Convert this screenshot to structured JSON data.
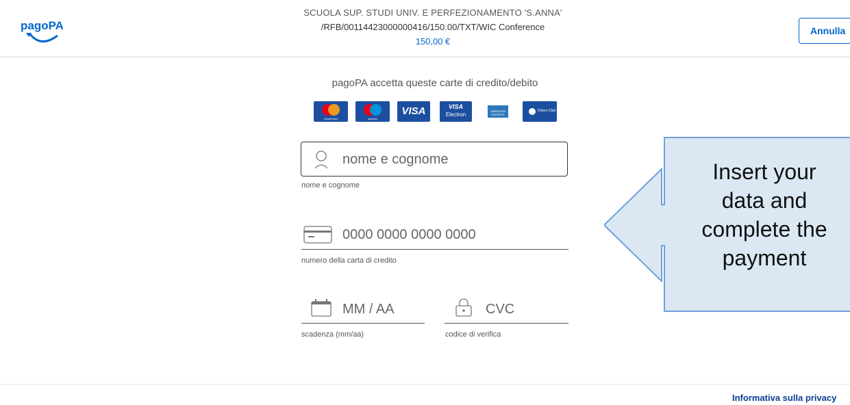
{
  "header": {
    "logo_text": "pagoPA",
    "recipient": "SCUOLA SUP. STUDI UNIV. E PERFEZIONAMENTO 'S.ANNA'",
    "reference": "/RFB/00114423000000416/150.00/TXT/WIC Conference",
    "amount": "150,00 €",
    "cancel_label": "Annulla"
  },
  "cards_section": {
    "heading": "pagoPA accetta queste carte di credito/debito",
    "cards": [
      {
        "name": "mastercard",
        "label": "mastercard"
      },
      {
        "name": "maestro",
        "label": "maestro"
      },
      {
        "name": "visa",
        "label": "VISA"
      },
      {
        "name": "visa-electron",
        "label": "VISA",
        "sub": "Electron"
      },
      {
        "name": "american-express",
        "label": "AMERICAN EXPRESS"
      },
      {
        "name": "diners-club",
        "label": "Diners Club"
      }
    ]
  },
  "form": {
    "name": {
      "placeholder": "nome e cognome",
      "value": "",
      "help": "nome e cognome",
      "icon": "user-icon"
    },
    "card_number": {
      "placeholder": "0000 0000 0000 0000",
      "value": "",
      "help": "numero della carta di credito",
      "icon": "credit-card-icon"
    },
    "expiry": {
      "placeholder": "MM / AA",
      "value": "",
      "help": "scadenza (mm/aa)",
      "icon": "calendar-icon"
    },
    "cvc": {
      "placeholder": "CVC",
      "value": "",
      "help": "codice di verifica",
      "icon": "lock-icon"
    }
  },
  "callout": {
    "lines": [
      "Insert your",
      "data and",
      "complete the",
      "payment"
    ],
    "fill": "#dbe8f4",
    "border": "#6f9fd8"
  },
  "footer": {
    "privacy_link": "Informativa sulla privacy"
  },
  "colors": {
    "accent": "#0066cc",
    "card_blue": "#1d4fa0"
  }
}
